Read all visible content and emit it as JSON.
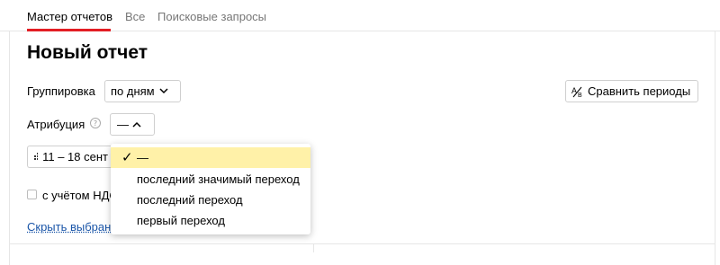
{
  "tabs": {
    "master": "Мастер отчетов",
    "all": "Все",
    "search": "Поисковые запросы"
  },
  "page": {
    "title": "Новый отчет"
  },
  "grouping": {
    "label": "Группировка",
    "value": "по дням"
  },
  "compare": {
    "label": "Сравнить периоды"
  },
  "attribution": {
    "label": "Атрибуция",
    "help": "?",
    "value": "—",
    "options": [
      "—",
      "последний значимый переход",
      "последний переход",
      "первый переход"
    ],
    "selected_index": 0
  },
  "date": {
    "value": "11 – 18 сент"
  },
  "vat": {
    "label": "с учётом НДС",
    "checked": false
  },
  "hide_link": {
    "label": "Скрыть выбранные"
  },
  "colors": {
    "accent": "#e31e24",
    "highlight": "#fff1a8",
    "link": "#1a55a8"
  }
}
